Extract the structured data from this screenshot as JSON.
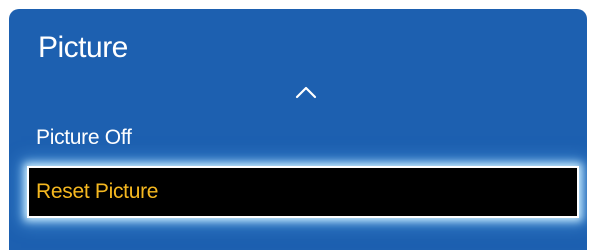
{
  "menu": {
    "title": "Picture",
    "scroll_up_icon": "chevron-up-icon",
    "items": [
      {
        "label": "Picture Off",
        "selected": false
      },
      {
        "label": "Reset Picture",
        "selected": true
      }
    ]
  },
  "colors": {
    "panel_background": "#1d60b0",
    "text": "#ffffff",
    "selected_background": "#000000",
    "selected_text": "#f5b820",
    "selection_border": "#ffffff"
  }
}
